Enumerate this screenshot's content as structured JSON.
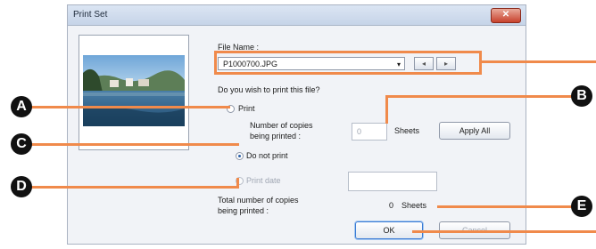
{
  "window": {
    "title": "Print Set",
    "close_glyph": "✕"
  },
  "file": {
    "label": "File Name :",
    "selected": "P1000700.JPG",
    "prev_glyph": "◂",
    "next_glyph": "▸"
  },
  "question": "Do you wish to print this file?",
  "print": {
    "label": "Print",
    "copies_label_1": "Number of copies",
    "copies_label_2": "being printed :",
    "copies_value": "0",
    "sheets_label": "Sheets",
    "apply_all": "Apply All"
  },
  "do_not_print": {
    "label": "Do not print"
  },
  "print_date": {
    "label": "Print date"
  },
  "total": {
    "label_1": "Total number of copies",
    "label_2": "being printed :",
    "value": "0",
    "unit": "Sheets"
  },
  "buttons": {
    "ok": "OK",
    "cancel": "Cancel"
  },
  "callouts": [
    "A",
    "B",
    "C",
    "D",
    "E"
  ],
  "accent_color": "#f08a4b"
}
